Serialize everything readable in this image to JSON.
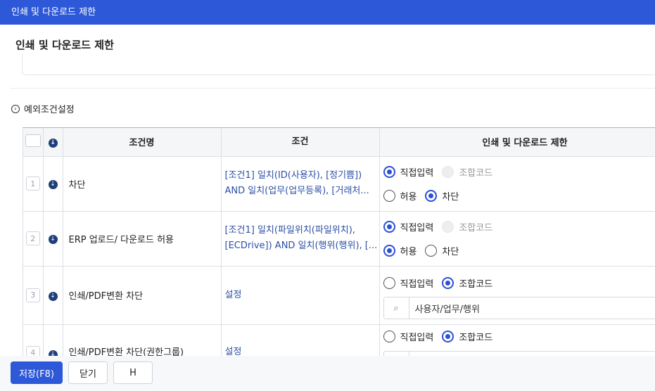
{
  "window": {
    "title": "인쇄 및 다운로드 제한"
  },
  "sheet": {
    "title": "인쇄 및 다운로드 제한"
  },
  "section": {
    "title": "예외조건설정"
  },
  "table": {
    "headers": {
      "name": "조건명",
      "condition": "조건",
      "restriction": "인쇄 및 다운로드 제한"
    },
    "rows": [
      {
        "num": "1",
        "name": "차단",
        "cond1": "[조건1] 일치(ID(사용자), [정기쁨])",
        "cond2": "AND 일치(업무(업무등록), [거래처...",
        "mode_direct": "직접입력",
        "mode_combo": "조합코드",
        "allow": "허용",
        "block": "차단"
      },
      {
        "num": "2",
        "name": "ERP 업로드/ 다운로드 허용",
        "cond1": "[조건1] 일치(파일위치(파일위치),",
        "cond2": "[ECDrive]) AND 일치(행위(행위), [...",
        "mode_direct": "직접입력",
        "mode_combo": "조합코드",
        "allow": "허용",
        "block": "차단"
      },
      {
        "num": "3",
        "name": "인쇄/PDF변환 차단",
        "cond1": "설정",
        "mode_direct": "직접입력",
        "mode_combo": "조합코드",
        "search_value": "사용자/업무/행위"
      },
      {
        "num": "4",
        "name": "인쇄/PDF변환 차단(권한그룹)",
        "cond1": "설정",
        "mode_direct": "직접입력",
        "mode_combo": "조합코드"
      }
    ]
  },
  "footer": {
    "save_label": "저장(F8)",
    "close_label": "닫기",
    "h_label": "H"
  }
}
